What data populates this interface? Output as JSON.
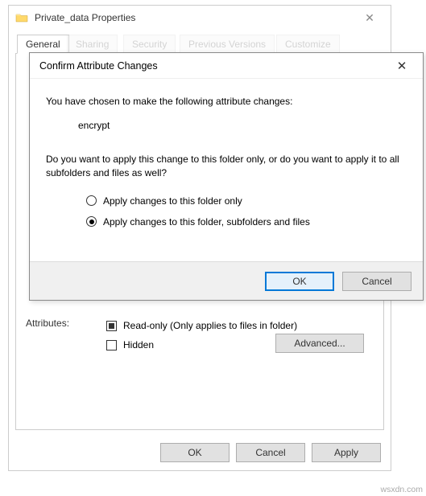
{
  "props": {
    "title": "Private_data Properties",
    "tabs": {
      "general": "General",
      "sharing": "Sharing",
      "security": "Security",
      "previous": "Previous Versions",
      "customize": "Customize"
    },
    "attributes": {
      "label": "Attributes:",
      "readonly": "Read-only (Only applies to files in folder)",
      "hidden": "Hidden",
      "advanced": "Advanced..."
    },
    "buttons": {
      "ok": "OK",
      "cancel": "Cancel",
      "apply": "Apply"
    }
  },
  "confirm": {
    "title": "Confirm Attribute Changes",
    "intro": "You have chosen to make the following attribute changes:",
    "change": "encrypt",
    "question": "Do you want to apply this change to this folder only, or do you want to apply it to all subfolders and files as well?",
    "opt1": "Apply changes to this folder only",
    "opt2": "Apply changes to this folder, subfolders and files",
    "ok": "OK",
    "cancel": "Cancel"
  },
  "watermark": "wsxdn.com"
}
